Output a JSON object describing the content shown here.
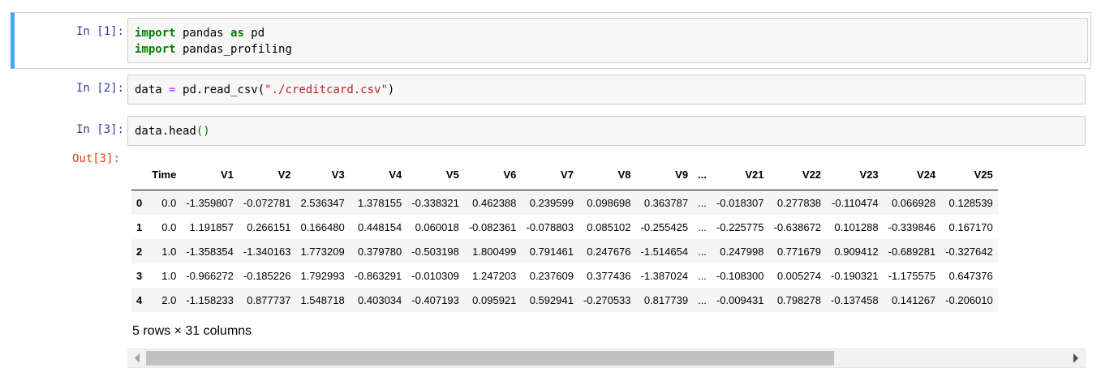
{
  "cells": [
    {
      "prompt": "In [1]:",
      "lines": [
        [
          {
            "t": "import",
            "c": "kw"
          },
          {
            "t": " pandas "
          },
          {
            "t": "as",
            "c": "kw"
          },
          {
            "t": " pd"
          }
        ],
        [
          {
            "t": "import",
            "c": "kw"
          },
          {
            "t": " pandas_profiling"
          }
        ]
      ]
    },
    {
      "prompt": "In [2]:",
      "lines": [
        [
          {
            "t": "data "
          },
          {
            "t": "=",
            "c": "op"
          },
          {
            "t": " pd.read_csv("
          },
          {
            "t": "\"./creditcard.csv\"",
            "c": "str"
          },
          {
            "t": ")"
          }
        ]
      ]
    },
    {
      "prompt": "In [3]:",
      "lines": [
        [
          {
            "t": "data.head"
          },
          {
            "t": "()",
            "c": "paren"
          }
        ]
      ]
    }
  ],
  "output_prompt": "Out[3]:",
  "table": {
    "columns": [
      "",
      "Time",
      "V1",
      "V2",
      "V3",
      "V4",
      "V5",
      "V6",
      "V7",
      "V8",
      "V9",
      "...",
      "V21",
      "V22",
      "V23",
      "V24",
      "V25"
    ],
    "rows": [
      [
        "0",
        "0.0",
        "-1.359807",
        "-0.072781",
        "2.536347",
        "1.378155",
        "-0.338321",
        "0.462388",
        "0.239599",
        "0.098698",
        "0.363787",
        "...",
        "-0.018307",
        "0.277838",
        "-0.110474",
        "0.066928",
        "0.128539"
      ],
      [
        "1",
        "0.0",
        "1.191857",
        "0.266151",
        "0.166480",
        "0.448154",
        "0.060018",
        "-0.082361",
        "-0.078803",
        "0.085102",
        "-0.255425",
        "...",
        "-0.225775",
        "-0.638672",
        "0.101288",
        "-0.339846",
        "0.167170"
      ],
      [
        "2",
        "1.0",
        "-1.358354",
        "-1.340163",
        "1.773209",
        "0.379780",
        "-0.503198",
        "1.800499",
        "0.791461",
        "0.247676",
        "-1.514654",
        "...",
        "0.247998",
        "0.771679",
        "0.909412",
        "-0.689281",
        "-0.327642"
      ],
      [
        "3",
        "1.0",
        "-0.966272",
        "-0.185226",
        "1.792993",
        "-0.863291",
        "-0.010309",
        "1.247203",
        "0.237609",
        "0.377436",
        "-1.387024",
        "...",
        "-0.108300",
        "0.005274",
        "-0.190321",
        "-1.175575",
        "0.647376"
      ],
      [
        "4",
        "2.0",
        "-1.158233",
        "0.877737",
        "1.548718",
        "0.403034",
        "-0.407193",
        "0.095921",
        "0.592941",
        "-0.270533",
        "0.817739",
        "...",
        "-0.009431",
        "0.798278",
        "-0.137458",
        "0.141267",
        "-0.206010"
      ]
    ]
  },
  "summary": "5 rows × 31 columns"
}
